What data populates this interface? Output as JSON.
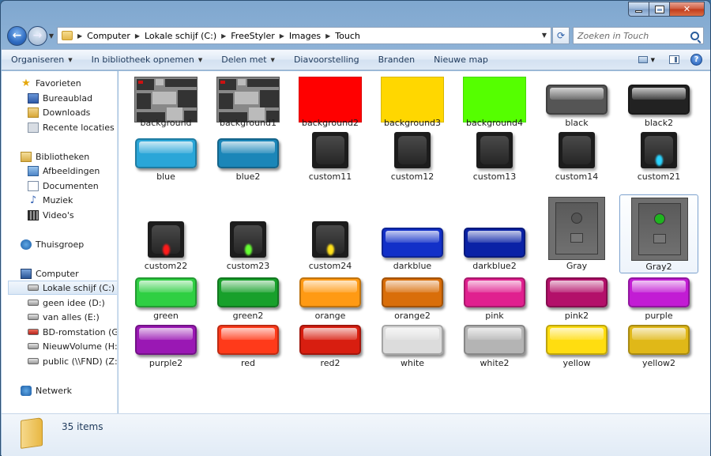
{
  "address": {
    "crumbs": [
      "Computer",
      "Lokale schijf (C:)",
      "FreeStyler",
      "Images",
      "Touch"
    ]
  },
  "search": {
    "placeholder": "Zoeken in Touch"
  },
  "toolbar": {
    "organize": "Organiseren",
    "include_library": "In bibliotheek opnemen",
    "share": "Delen met",
    "slideshow": "Diavoorstelling",
    "burn": "Branden",
    "new_folder": "Nieuwe map"
  },
  "nav": {
    "favorites": "Favorieten",
    "desktop": "Bureaublad",
    "downloads": "Downloads",
    "recent": "Recente locaties",
    "libraries": "Bibliotheken",
    "pictures": "Afbeeldingen",
    "documents": "Documenten",
    "music": "Muziek",
    "videos": "Video's",
    "homegroup": "Thuisgroep",
    "computer": "Computer",
    "drive_c": "Lokale schijf (C:)",
    "drive_d": "geen idee (D:)",
    "drive_e": "van alles (E:)",
    "drive_g": "BD-romstation (G:) N",
    "drive_h": "NieuwVolume (H:)",
    "drive_z": "public (\\\\FND) (Z:)",
    "network": "Netwerk"
  },
  "files": [
    {
      "name": "background",
      "kind": "bg",
      "color": "#888888"
    },
    {
      "name": "background1",
      "kind": "bg",
      "color": "#888888"
    },
    {
      "name": "background2",
      "kind": "solid",
      "color": "#ff0000"
    },
    {
      "name": "background3",
      "kind": "solid",
      "color": "#ffd700"
    },
    {
      "name": "background4",
      "kind": "solid",
      "color": "#55ff00"
    },
    {
      "name": "black",
      "kind": "btn",
      "color": "#555555"
    },
    {
      "name": "black2",
      "kind": "btn",
      "color": "#222222"
    },
    {
      "name": "blue",
      "kind": "btn",
      "color": "#2aa6d8"
    },
    {
      "name": "blue2",
      "kind": "btn",
      "color": "#1b86b8"
    },
    {
      "name": "custom11",
      "kind": "dark",
      "color": "#1c1c1c"
    },
    {
      "name": "custom12",
      "kind": "dark",
      "color": "#1c1c1c"
    },
    {
      "name": "custom13",
      "kind": "dark",
      "color": "#1c1c1c"
    },
    {
      "name": "custom14",
      "kind": "dark",
      "color": "#1c1c1c"
    },
    {
      "name": "custom21",
      "kind": "dark",
      "color": "#1c1c1c",
      "led": "#2ad4ff"
    },
    {
      "name": "custom22",
      "kind": "dark",
      "color": "#1c1c1c",
      "led": "#ff1a1a"
    },
    {
      "name": "custom23",
      "kind": "dark",
      "color": "#1c1c1c",
      "led": "#66ff33"
    },
    {
      "name": "custom24",
      "kind": "dark",
      "color": "#1c1c1c",
      "led": "#ffe01a"
    },
    {
      "name": "darkblue",
      "kind": "btn",
      "color": "#1230c8"
    },
    {
      "name": "darkblue2",
      "kind": "btn",
      "color": "#0a22a6"
    },
    {
      "name": "Gray",
      "kind": "gray",
      "color": "#6f6f6f",
      "dot": "#555555"
    },
    {
      "name": "Gray2",
      "kind": "gray",
      "color": "#6f6f6f",
      "dot": "#1fb41f"
    },
    {
      "name": "green",
      "kind": "btn",
      "color": "#2fcf43"
    },
    {
      "name": "green2",
      "kind": "btn",
      "color": "#18a02b"
    },
    {
      "name": "orange",
      "kind": "btn",
      "color": "#ff9a14"
    },
    {
      "name": "orange2",
      "kind": "btn",
      "color": "#d96e0a"
    },
    {
      "name": "pink",
      "kind": "btn",
      "color": "#e0208f"
    },
    {
      "name": "pink2",
      "kind": "btn",
      "color": "#b3106a"
    },
    {
      "name": "purple",
      "kind": "btn",
      "color": "#c21cd4"
    },
    {
      "name": "purple2",
      "kind": "btn",
      "color": "#9a18b4"
    },
    {
      "name": "red",
      "kind": "btn",
      "color": "#ff3a1a"
    },
    {
      "name": "red2",
      "kind": "btn",
      "color": "#d81e10"
    },
    {
      "name": "white",
      "kind": "btn",
      "color": "#dcdcdc"
    },
    {
      "name": "white2",
      "kind": "btn",
      "color": "#b4b4b4"
    },
    {
      "name": "yellow",
      "kind": "btn",
      "color": "#ffdd10"
    },
    {
      "name": "yellow2",
      "kind": "btn",
      "color": "#e0b818"
    }
  ],
  "selected_file": "Gray2",
  "status": {
    "count": "35 items"
  }
}
